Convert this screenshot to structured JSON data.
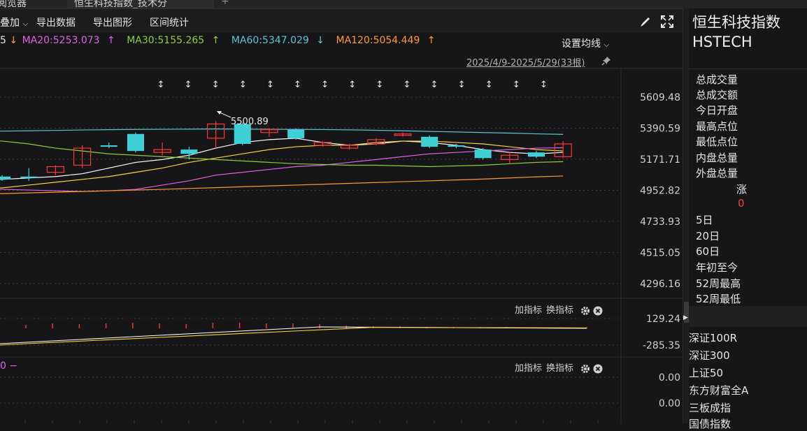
{
  "tabs": {
    "left": "阅览器",
    "active": "恒生科技指数_技术分"
  },
  "toolbar": {
    "overlay": "叠加",
    "export_data": "导出数据",
    "export_chart": "导出图形",
    "range_stats": "区间统计",
    "icons": [
      "brush-icon",
      "fullscreen-icon"
    ]
  },
  "ma": {
    "lead_value": "5",
    "lead_arrow": "↓",
    "items": [
      {
        "label": "MA20:5253.073",
        "arrow": "↑",
        "color": "#e060e6"
      },
      {
        "label": "MA30:5155.265",
        "arrow": "↑",
        "color": "#8fce3a"
      },
      {
        "label": "MA60:5347.029",
        "arrow": "↓",
        "color": "#5bc6cf"
      },
      {
        "label": "MA120:5054.449",
        "arrow": "↑",
        "color": "#ff9a2e"
      }
    ],
    "lead_arrow_color": "#ff9a2e",
    "settings_label": "设置均线"
  },
  "range_text": "2025/4/9-2025/5/29(33根)",
  "chart_data": {
    "type": "candlestick",
    "price_axis": {
      "ticks": [
        5609.48,
        5390.59,
        5171.71,
        4952.82,
        4733.93,
        4515.05,
        4296.16
      ],
      "ylim": [
        4296.16,
        5609.48
      ]
    },
    "annotation": {
      "label": "5500.89",
      "value": 5500.89
    },
    "candles": [
      {
        "o": 5030,
        "c": 5050,
        "h": 5060,
        "l": 5020,
        "up": false
      },
      {
        "o": 5040,
        "c": 5050,
        "h": 5110,
        "l": 5020,
        "up": false
      },
      {
        "o": 5080,
        "c": 5120,
        "h": 5130,
        "l": 5060,
        "up": true
      },
      {
        "o": 5130,
        "c": 5250,
        "h": 5270,
        "l": 5110,
        "up": true
      },
      {
        "o": 5270,
        "c": 5260,
        "h": 5290,
        "l": 5250,
        "up": false
      },
      {
        "o": 5350,
        "c": 5230,
        "h": 5360,
        "l": 5220,
        "up": false
      },
      {
        "o": 5220,
        "c": 5240,
        "h": 5290,
        "l": 5200,
        "up": true
      },
      {
        "o": 5240,
        "c": 5210,
        "h": 5260,
        "l": 5170,
        "up": false
      },
      {
        "o": 5320,
        "c": 5420,
        "h": 5440,
        "l": 5250,
        "up": true
      },
      {
        "o": 5420,
        "c": 5280,
        "h": 5430,
        "l": 5270,
        "up": false
      },
      {
        "o": 5360,
        "c": 5380,
        "h": 5390,
        "l": 5330,
        "up": true
      },
      {
        "o": 5380,
        "c": 5320,
        "h": 5390,
        "l": 5310,
        "up": false
      },
      {
        "o": 5270,
        "c": 5290,
        "h": 5300,
        "l": 5260,
        "up": true
      },
      {
        "o": 5250,
        "c": 5270,
        "h": 5280,
        "l": 5240,
        "up": true
      },
      {
        "o": 5280,
        "c": 5310,
        "h": 5320,
        "l": 5270,
        "up": true
      },
      {
        "o": 5340,
        "c": 5350,
        "h": 5360,
        "l": 5330,
        "up": true
      },
      {
        "o": 5330,
        "c": 5260,
        "h": 5340,
        "l": 5250,
        "up": false
      },
      {
        "o": 5270,
        "c": 5260,
        "h": 5280,
        "l": 5250,
        "up": false
      },
      {
        "o": 5240,
        "c": 5180,
        "h": 5250,
        "l": 5170,
        "up": false
      },
      {
        "o": 5170,
        "c": 5200,
        "h": 5220,
        "l": 5140,
        "up": true
      },
      {
        "o": 5220,
        "c": 5190,
        "h": 5230,
        "l": 5180,
        "up": false
      },
      {
        "o": 5190,
        "c": 5280,
        "h": 5300,
        "l": 5180,
        "up": true
      }
    ],
    "event_markers": 15,
    "ma_lines": [
      {
        "name": "MA5",
        "color": "#ffffff",
        "values": [
          5030,
          5040,
          5050,
          5070,
          5110,
          5150,
          5170,
          5200,
          5250,
          5290,
          5310,
          5320,
          5290,
          5270,
          5280,
          5300,
          5290,
          5270,
          5240,
          5220,
          5210,
          5220
        ]
      },
      {
        "name": "MA10",
        "color": "#f5d33a",
        "values": [
          4970,
          4990,
          5010,
          5030,
          5050,
          5080,
          5110,
          5150,
          5180,
          5210,
          5240,
          5260,
          5270,
          5270,
          5290,
          5300,
          5300,
          5290,
          5280,
          5260,
          5240,
          5230
        ]
      },
      {
        "name": "MA20",
        "color": "#e060e6",
        "values": [
          4960,
          4955,
          4950,
          4945,
          4950,
          4960,
          4990,
          5020,
          5060,
          5080,
          5100,
          5120,
          5130,
          5150,
          5170,
          5190,
          5210,
          5220,
          5230,
          5240,
          5250,
          5253
        ]
      },
      {
        "name": "MA30",
        "color": "#8fce3a",
        "values": [
          5300,
          5280,
          5250,
          5230,
          5210,
          5200,
          5190,
          5180,
          5170,
          5160,
          5150,
          5140,
          5135,
          5130,
          5130,
          5125,
          5120,
          5125,
          5130,
          5140,
          5150,
          5155
        ]
      },
      {
        "name": "MA60",
        "color": "#5bc6cf",
        "values": [
          5370,
          5372,
          5375,
          5378,
          5380,
          5382,
          5383,
          5384,
          5385,
          5384,
          5383,
          5382,
          5381,
          5379,
          5376,
          5372,
          5368,
          5364,
          5360,
          5356,
          5351,
          5347
        ]
      },
      {
        "name": "MA120",
        "color": "#ff9a2e",
        "values": [
          4930,
          4935,
          4940,
          4945,
          4950,
          4955,
          4960,
          4966,
          4972,
          4978,
          4984,
          4990,
          4996,
          5002,
          5008,
          5014,
          5020,
          5026,
          5032,
          5040,
          5048,
          5054
        ]
      }
    ]
  },
  "sub1": {
    "ticks": [
      "129.24",
      "-285.35"
    ],
    "add_indicator": "加指标",
    "switch_indicator": "换指标"
  },
  "sub2": {
    "lead": "0 −",
    "ticks": [
      "0.00",
      "0.00"
    ],
    "add_indicator": "加指标",
    "switch_indicator": "换指标"
  },
  "panel": {
    "title_cn": "恒生科技指数",
    "title_en": "HSTECH",
    "stats": [
      "总成交量",
      "总成交额",
      "今日开盘",
      "最高点位",
      "最低点位",
      "内盘总量",
      "外盘总量"
    ],
    "change_label": "涨",
    "change_value": "0",
    "periods": [
      "5日",
      "20日",
      "60日",
      "年初至今",
      "52周最高",
      "52周最低"
    ],
    "indices": [
      "深证100R",
      "深证300",
      "上证50",
      "东方财富全A",
      "三板成指",
      "国债指数"
    ]
  },
  "colors": {
    "up": "#ff3535",
    "down": "#3fd0d6",
    "grid": "#3a3a3e"
  }
}
